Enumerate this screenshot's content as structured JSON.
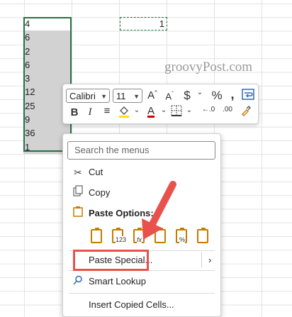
{
  "sheet": {
    "column_a": [
      "4",
      "6",
      "2",
      "6",
      "3",
      "12",
      "25",
      "9",
      "36",
      "1"
    ],
    "copied_cell": "1"
  },
  "watermark": "groovyPost.com",
  "minibar": {
    "font": "Calibri",
    "size": "11",
    "currency": "$",
    "percent": "%",
    "comma": ",",
    "bold": "B",
    "italic": "I",
    "increase_font": "A",
    "decrease_font": "A",
    "font_color_letter": "A",
    "decimal_increase": "←.0",
    "decimal_decrease": ".00",
    "accent_colors": {
      "highlight": "#ffe000",
      "font_color": "#d00000"
    }
  },
  "context_menu": {
    "search_placeholder": "Search the menus",
    "cut": "Cut",
    "copy": "Copy",
    "paste_options_heading": "Paste Options:",
    "paste_icon_subs": [
      "",
      "123",
      "fx",
      "",
      "%",
      ""
    ],
    "paste_special": "Paste Special...",
    "smart_lookup": "Smart Lookup",
    "insert_copied": "Insert Copied Cells..."
  },
  "annotation_color": "#e8524a"
}
